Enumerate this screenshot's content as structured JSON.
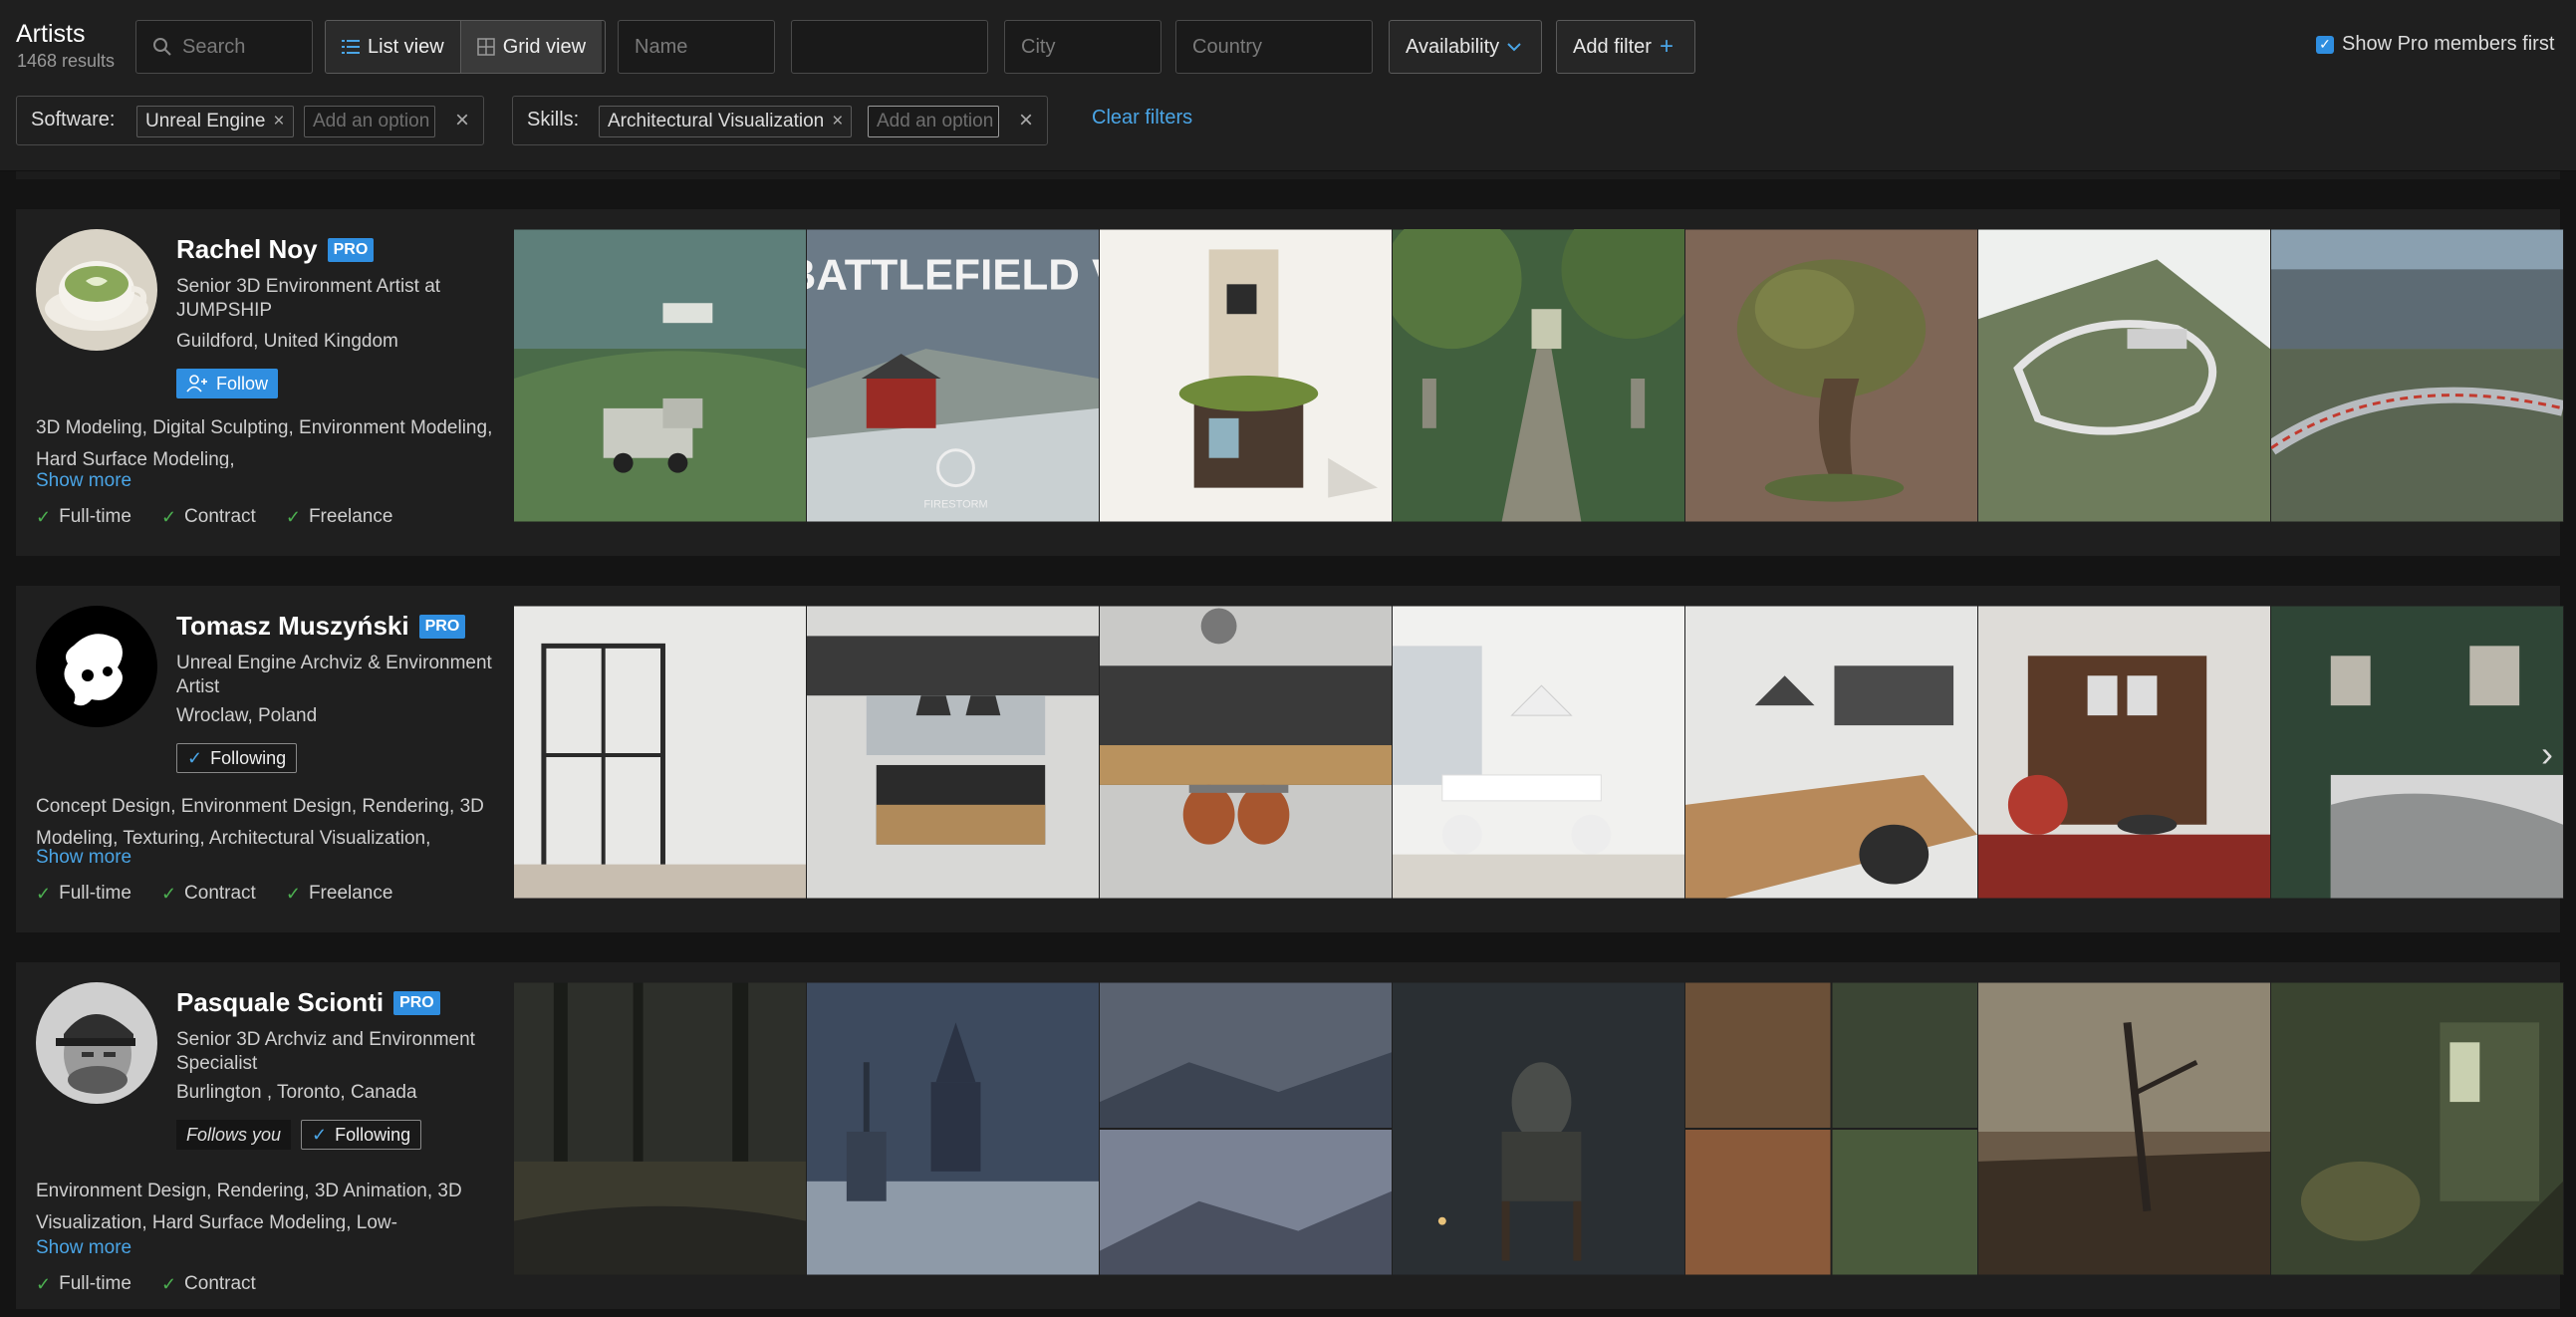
{
  "header": {
    "title": "Artists",
    "results": "1468 results",
    "search_placeholder": "Search",
    "view_list": "List view",
    "view_grid": "Grid view",
    "name_placeholder": "Name",
    "city_placeholder": "City",
    "country_placeholder": "Country",
    "availability": "Availability",
    "add_filter": "Add filter",
    "show_pro_first": "Show Pro members first"
  },
  "filters": {
    "software_label": "Software:",
    "software_chip": "Unreal Engine",
    "skills_label": "Skills:",
    "skills_chip": "Architectural Visualization",
    "add_option": "Add an option",
    "clear": "Clear filters"
  },
  "artists": [
    {
      "name": "Rachel Noy",
      "badge": "PRO",
      "title": "Senior 3D Environment Artist at JUMPSHIP",
      "location": "Guildford, United Kingdom",
      "follow": "Follow",
      "skills": "3D Modeling, Digital Sculpting, Environment Modeling, Hard Surface Modeling,",
      "show_more": "Show more",
      "availability": [
        "Full-time",
        "Contract",
        "Freelance"
      ]
    },
    {
      "name": "Tomasz Muszyński",
      "badge": "PRO",
      "title": "Unreal Engine Archviz & Environment Artist",
      "location": "Wroclaw, Poland",
      "follow": "Following",
      "skills": "Concept Design, Environment Design, Rendering, 3D Modeling, Texturing, Architectural Visualization,",
      "show_more": "Show more",
      "availability": [
        "Full-time",
        "Contract",
        "Freelance"
      ]
    },
    {
      "name": "Pasquale Scionti",
      "badge": "PRO",
      "title": "Senior 3D Archviz and Environment Specialist",
      "location": "Burlington , Toronto, Canada",
      "follows_you": "Follows you",
      "follow": "Following",
      "skills": "Environment Design, Rendering, 3D Animation, 3D Visualization, Hard Surface Modeling, Low-",
      "show_more": "Show more",
      "availability": [
        "Full-time",
        "Contract"
      ]
    }
  ],
  "artwork": {
    "battlefield_title": "BATTLEFIELD V",
    "battlefield_logo_text": "FIRESTORM"
  },
  "colors": {
    "accent": "#2f8ee0",
    "link": "#4aa5e6",
    "check": "#4caf50"
  }
}
